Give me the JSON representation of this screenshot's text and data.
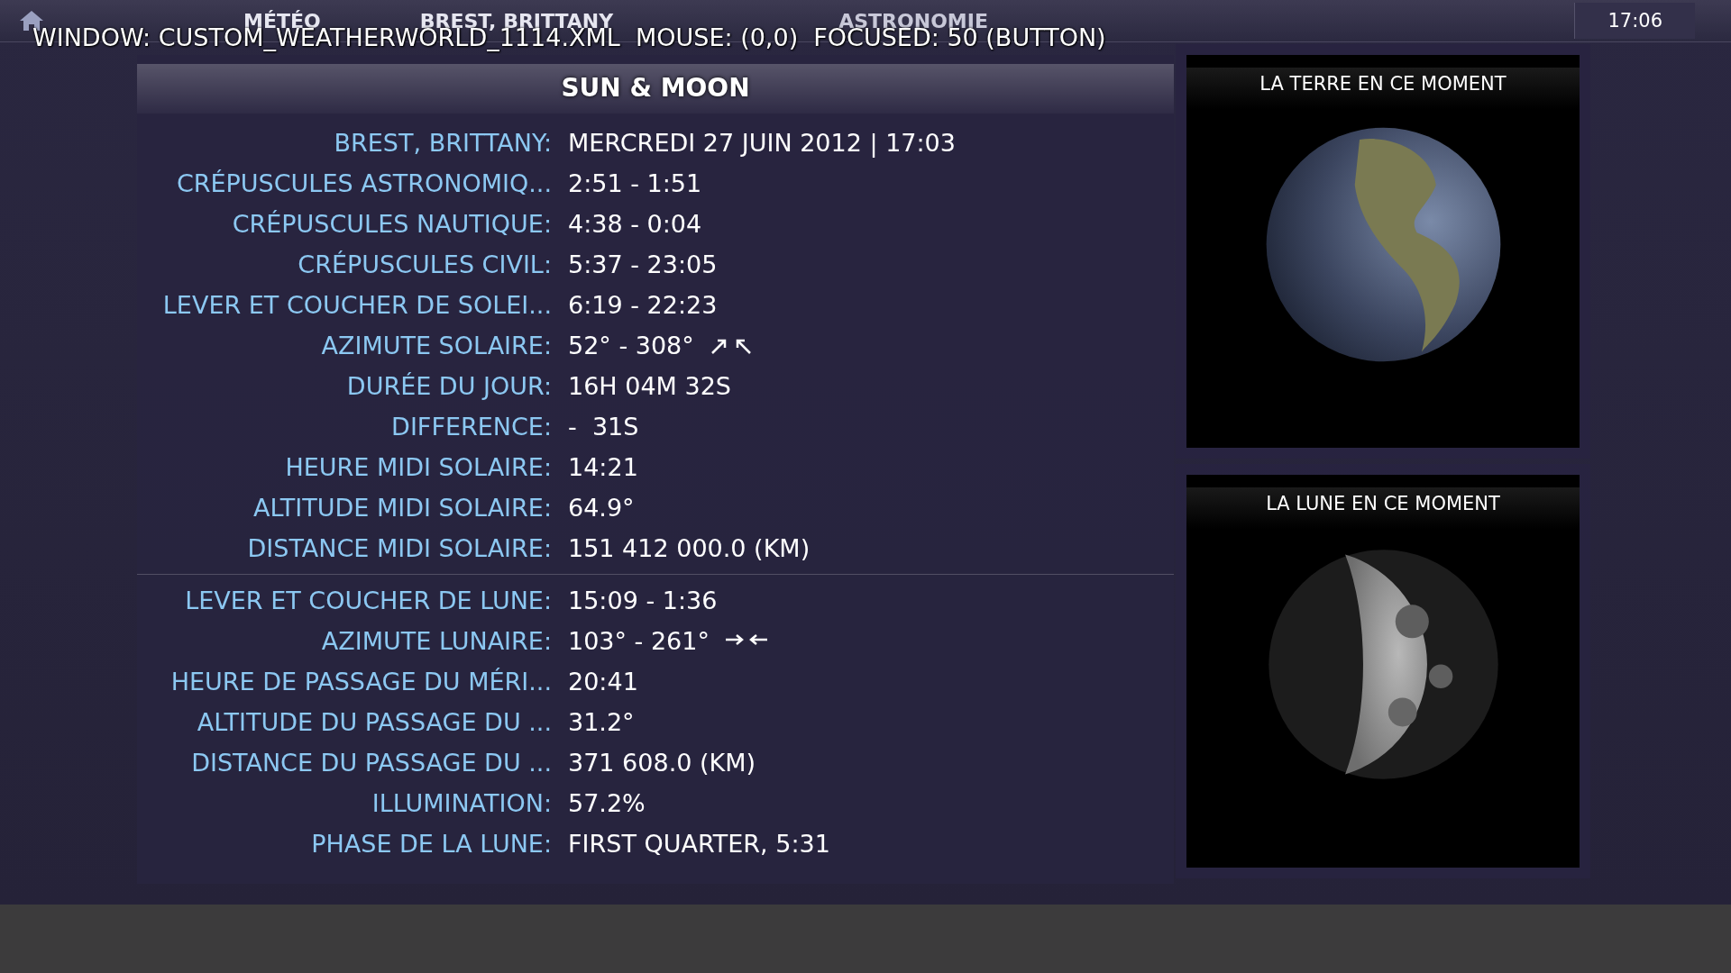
{
  "top_bar": {
    "tabs": [
      {
        "label": "MÉTÉO"
      },
      {
        "label": "BREST, BRITTANY"
      },
      {
        "label": "ASTRONOMIE"
      }
    ],
    "clock": "17:06"
  },
  "debug_overlay": "WINDOW: CUSTOM_WEATHERWORLD_1114.XML  MOUSE: (0,0)  FOCUSED: 50 (BUTTON)",
  "panel": {
    "title": "SUN & MOON",
    "sections": [
      {
        "rows": [
          {
            "label": "BREST, BRITTANY:",
            "value": "MERCREDI 27 JUIN 2012 | 17:03",
            "kind": "plain"
          },
          {
            "label": "CRÉPUSCULES ASTRONOMIQ...",
            "value": "2:51 - 1:51",
            "kind": "plain"
          },
          {
            "label": "CRÉPUSCULES NAUTIQUE:",
            "value": "4:38 - 0:04",
            "kind": "plain"
          },
          {
            "label": "CRÉPUSCULES CIVIL:",
            "value": "5:37 - 23:05",
            "kind": "plain"
          },
          {
            "label": "LEVER ET COUCHER DE SOLEI...",
            "value": "6:19 - 22:23",
            "kind": "plain"
          },
          {
            "label": "AZIMUTE SOLAIRE:",
            "value": "52° - 308°",
            "kind": "azimuth_diagonal"
          },
          {
            "label": "DURÉE DU JOUR:",
            "value": "16H 04M 32S",
            "kind": "plain"
          },
          {
            "label": "DIFFERENCE:",
            "value": "-  31S",
            "kind": "plain"
          },
          {
            "label": "HEURE MIDI SOLAIRE:",
            "value": "14:21",
            "kind": "plain"
          },
          {
            "label": "ALTITUDE MIDI SOLAIRE:",
            "value": "64.9°",
            "kind": "plain"
          },
          {
            "label": "DISTANCE MIDI SOLAIRE:",
            "value": "151 412 000.0 (KM)",
            "kind": "plain"
          }
        ]
      },
      {
        "rows": [
          {
            "label": "LEVER ET COUCHER DE LUNE:",
            "value": "15:09 - 1:36",
            "kind": "plain"
          },
          {
            "label": "AZIMUTE LUNAIRE:",
            "value": "103° - 261°",
            "kind": "azimuth_horizontal"
          },
          {
            "label": "HEURE DE PASSAGE DU MÉRI...",
            "value": "20:41",
            "kind": "plain"
          },
          {
            "label": "ALTITUDE DU PASSAGE DU ...",
            "value": "31.2°",
            "kind": "plain"
          },
          {
            "label": "DISTANCE DU PASSAGE DU ...",
            "value": "371 608.0 (KM)",
            "kind": "plain"
          },
          {
            "label": "ILLUMINATION:",
            "value": "57.2%",
            "kind": "plain"
          },
          {
            "label": "PHASE DE LA LUNE:",
            "value": "FIRST QUARTER, 5:31",
            "kind": "plain"
          }
        ]
      }
    ]
  },
  "side_panels": [
    {
      "title": "LA TERRE EN CE MOMENT",
      "kind": "earth"
    },
    {
      "title": "LA LUNE EN CE MOMENT",
      "kind": "moon"
    }
  ]
}
